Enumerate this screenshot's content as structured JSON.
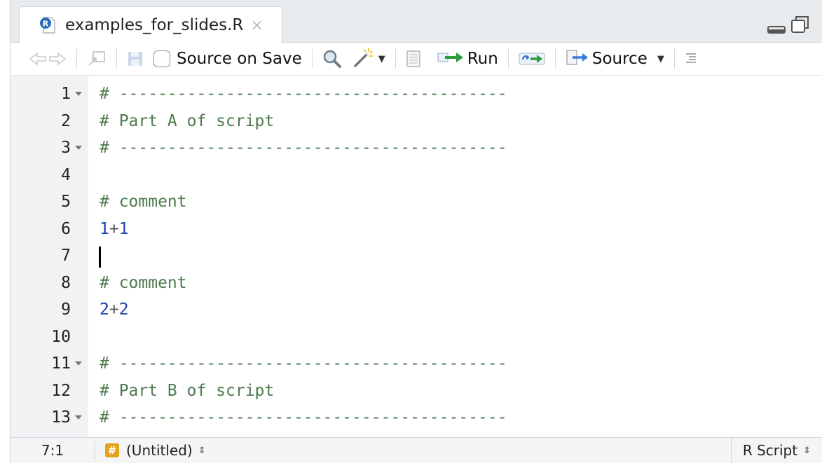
{
  "tab": {
    "title": "examples_for_slides.R",
    "close": "×",
    "file_icon": "r-file-icon"
  },
  "toolbar": {
    "source_on_save": "Source on Save",
    "run": "Run",
    "source": "Source"
  },
  "editor": {
    "lines": [
      {
        "n": "1",
        "fold": true,
        "text": "# ----------------------------------------"
      },
      {
        "n": "2",
        "fold": false,
        "text": "# Part A of script"
      },
      {
        "n": "3",
        "fold": true,
        "text": "# ----------------------------------------"
      },
      {
        "n": "4",
        "fold": false,
        "text": ""
      },
      {
        "n": "5",
        "fold": false,
        "text": "# comment"
      },
      {
        "n": "6",
        "fold": false,
        "a": "1",
        "op": "+",
        "b": "1"
      },
      {
        "n": "7",
        "fold": false,
        "text": ""
      },
      {
        "n": "8",
        "fold": false,
        "text": "# comment"
      },
      {
        "n": "9",
        "fold": false,
        "a": "2",
        "op": "+",
        "b": "2"
      },
      {
        "n": "10",
        "fold": false,
        "text": ""
      },
      {
        "n": "11",
        "fold": true,
        "text": "# ----------------------------------------"
      },
      {
        "n": "12",
        "fold": false,
        "text": "# Part B of script"
      },
      {
        "n": "13",
        "fold": true,
        "text": "# ----------------------------------------"
      }
    ]
  },
  "status": {
    "cursor_pos": "7:1",
    "section_icon": "#",
    "section": "(Untitled)",
    "file_type": "R Script",
    "updown": "⇕"
  },
  "colors": {
    "comment": "#4d7a4d",
    "number": "#1a3fb0",
    "run_arrow": "#2e9a3e",
    "source_arrow": "#3a7bd5"
  }
}
